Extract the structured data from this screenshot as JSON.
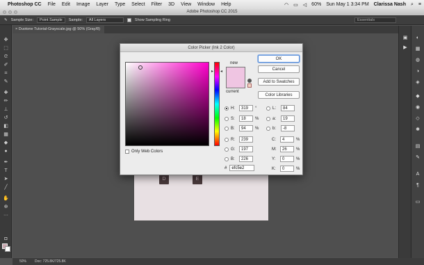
{
  "menubar": {
    "app": "Photoshop CC",
    "items": [
      "File",
      "Edit",
      "Image",
      "Layer",
      "Type",
      "Select",
      "Filter",
      "3D",
      "View",
      "Window",
      "Help"
    ],
    "battery": "60%",
    "clock": "Sun May 1  3:34 PM",
    "user": "Clarissa Nash"
  },
  "titlebar": {
    "title": "Adobe Photoshop CC 2015"
  },
  "options": {
    "sample_size_label": "Sample Size:",
    "sample_size_value": "Point Sample",
    "sample_label": "Sample:",
    "sample_value": "All Layers",
    "show_ring_label": "Show Sampling Ring",
    "workspace": "Essentials"
  },
  "document": {
    "tab": "Duotone Tutorial-Grayscale.jpg @ 50% (Gray/8)",
    "tiles": [
      "D",
      "E"
    ]
  },
  "status": {
    "zoom": "50%",
    "doc": "Doc: 725.8K/725.8K"
  },
  "picker": {
    "title": "Color Picker (Ink 2 Color)",
    "new_label": "new",
    "current_label": "current",
    "new_color": "#efc5e2",
    "current_color": "#efc5e2",
    "buttons": {
      "ok": "OK",
      "cancel": "Cancel",
      "add_swatches": "Add to Swatches",
      "libraries": "Color Libraries"
    },
    "only_web": "Only Web Colors",
    "hsb": [
      {
        "label": "H:",
        "value": "319",
        "unit": "°",
        "selected": true
      },
      {
        "label": "S:",
        "value": "18",
        "unit": "%",
        "selected": false
      },
      {
        "label": "B:",
        "value": "94",
        "unit": "%",
        "selected": false
      }
    ],
    "rgb": [
      {
        "label": "R:",
        "value": "239"
      },
      {
        "label": "G:",
        "value": "197"
      },
      {
        "label": "B:",
        "value": "226"
      }
    ],
    "lab": [
      {
        "label": "L:",
        "value": "84"
      },
      {
        "label": "a:",
        "value": "19"
      },
      {
        "label": "b:",
        "value": "-8"
      }
    ],
    "cmyk": [
      {
        "label": "C:",
        "value": "4",
        "unit": "%"
      },
      {
        "label": "M:",
        "value": "26",
        "unit": "%"
      },
      {
        "label": "Y:",
        "value": "0",
        "unit": "%"
      },
      {
        "label": "K:",
        "value": "0",
        "unit": "%"
      }
    ],
    "hex_label": "#",
    "hex_value": "efc5e2"
  }
}
